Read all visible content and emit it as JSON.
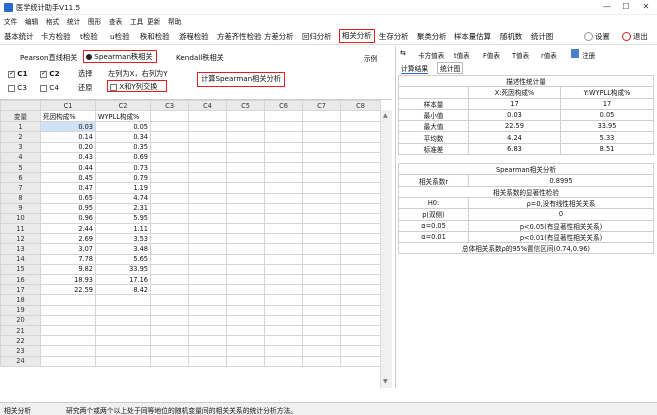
{
  "app": {
    "title": "医学统计助手V11.5"
  },
  "menu": [
    "文件",
    "编辑",
    "格式",
    "统计",
    "图形",
    "查表",
    "工具",
    "更新",
    "帮助"
  ],
  "toolbar": {
    "tabs": [
      "基本统计",
      "卡方检验",
      "t检验",
      "u检验",
      "秩和检验",
      "游程检验",
      "方差齐性检验",
      "方差分析",
      "回归分析",
      "相关分析",
      "生存分析",
      "聚类分析",
      "样本量估算",
      "随机数",
      "统计图"
    ],
    "active": "相关分析",
    "settings": "设置",
    "exit": "退出"
  },
  "methods": {
    "pearson": "Pearson直线相关",
    "spearman": "Spearman秩相关",
    "kendall": "Kendall秩相关",
    "example": "示例"
  },
  "options": {
    "c1": "C1",
    "c2": "C2",
    "c3": "C3",
    "c4": "C4",
    "select": "选择",
    "restore": "还原",
    "hint": "左列为X，右列为Y",
    "swap": "X和Y列交换",
    "compute": "计算Spearman相关分析"
  },
  "grid": {
    "headers": [
      "",
      "C1",
      "C2",
      "C3",
      "C4",
      "C5",
      "C6",
      "C7",
      "C8"
    ],
    "row1": [
      "变量",
      "死因构成%",
      "WYPLL构成%",
      "",
      "",
      "",
      "",
      "",
      ""
    ],
    "rows": [
      [
        "1",
        "0.03",
        "0.05"
      ],
      [
        "2",
        "0.14",
        "0.34"
      ],
      [
        "3",
        "0.20",
        "0.35"
      ],
      [
        "4",
        "0.43",
        "0.69"
      ],
      [
        "5",
        "0.44",
        "0.73"
      ],
      [
        "6",
        "0.45",
        "0.79"
      ],
      [
        "7",
        "0.47",
        "1.19"
      ],
      [
        "8",
        "0.65",
        "4.74"
      ],
      [
        "9",
        "0.95",
        "2.31"
      ],
      [
        "10",
        "0.96",
        "5.95"
      ],
      [
        "11",
        "2.44",
        "1.11"
      ],
      [
        "12",
        "2.69",
        "3.53"
      ],
      [
        "13",
        "3.07",
        "3.48"
      ],
      [
        "14",
        "7.78",
        "5.65"
      ],
      [
        "15",
        "9.82",
        "33.95"
      ],
      [
        "16",
        "18.93",
        "17.16"
      ],
      [
        "17",
        "22.59",
        "8.42"
      ],
      [
        "18",
        "",
        ""
      ],
      [
        "19",
        "",
        ""
      ],
      [
        "20",
        "",
        ""
      ],
      [
        "21",
        "",
        ""
      ],
      [
        "22",
        "",
        ""
      ],
      [
        "23",
        "",
        ""
      ],
      [
        "24",
        "",
        ""
      ]
    ]
  },
  "right_toolbar": {
    "items": [
      "卡方值表",
      "t值表",
      "F值表",
      "T值表",
      "r值表"
    ],
    "register": "注册"
  },
  "result_tabs": [
    "计算结果",
    "统计图"
  ],
  "results": {
    "desc_title": "描述性统计量",
    "desc_header": [
      "",
      "X:死因构成%",
      "Y:WYPLL构成%"
    ],
    "desc_rows": [
      [
        "样本量",
        "17",
        "17"
      ],
      [
        "最小值",
        "0.03",
        "0.05"
      ],
      [
        "最大值",
        "22.59",
        "33.95"
      ],
      [
        "平均数",
        "4.24",
        "5.33"
      ],
      [
        "标准差",
        "6.83",
        "8.51"
      ]
    ],
    "spearman_title": "Spearman相关分析",
    "coef_label": "相关系数r",
    "coef_value": "0.8995",
    "sig_title": "相关系数的显著性检验",
    "sig_rows": [
      [
        "H0:",
        "ρ=0,没有线性相关关系"
      ],
      [
        "p(双侧)",
        "0"
      ],
      [
        "α=0.05",
        "p<0.05(有显著性相关关系)"
      ],
      [
        "α=0.01",
        "p<0.01(有显著性相关关系)"
      ]
    ],
    "ci_text": "总体相关系数ρ的95%置信区间(0.74,0.96)"
  },
  "status": {
    "left": "相关分析",
    "right": "研究两个或两个以上处于同等地位的随机变量间的相关关系的统计分析方法。"
  }
}
